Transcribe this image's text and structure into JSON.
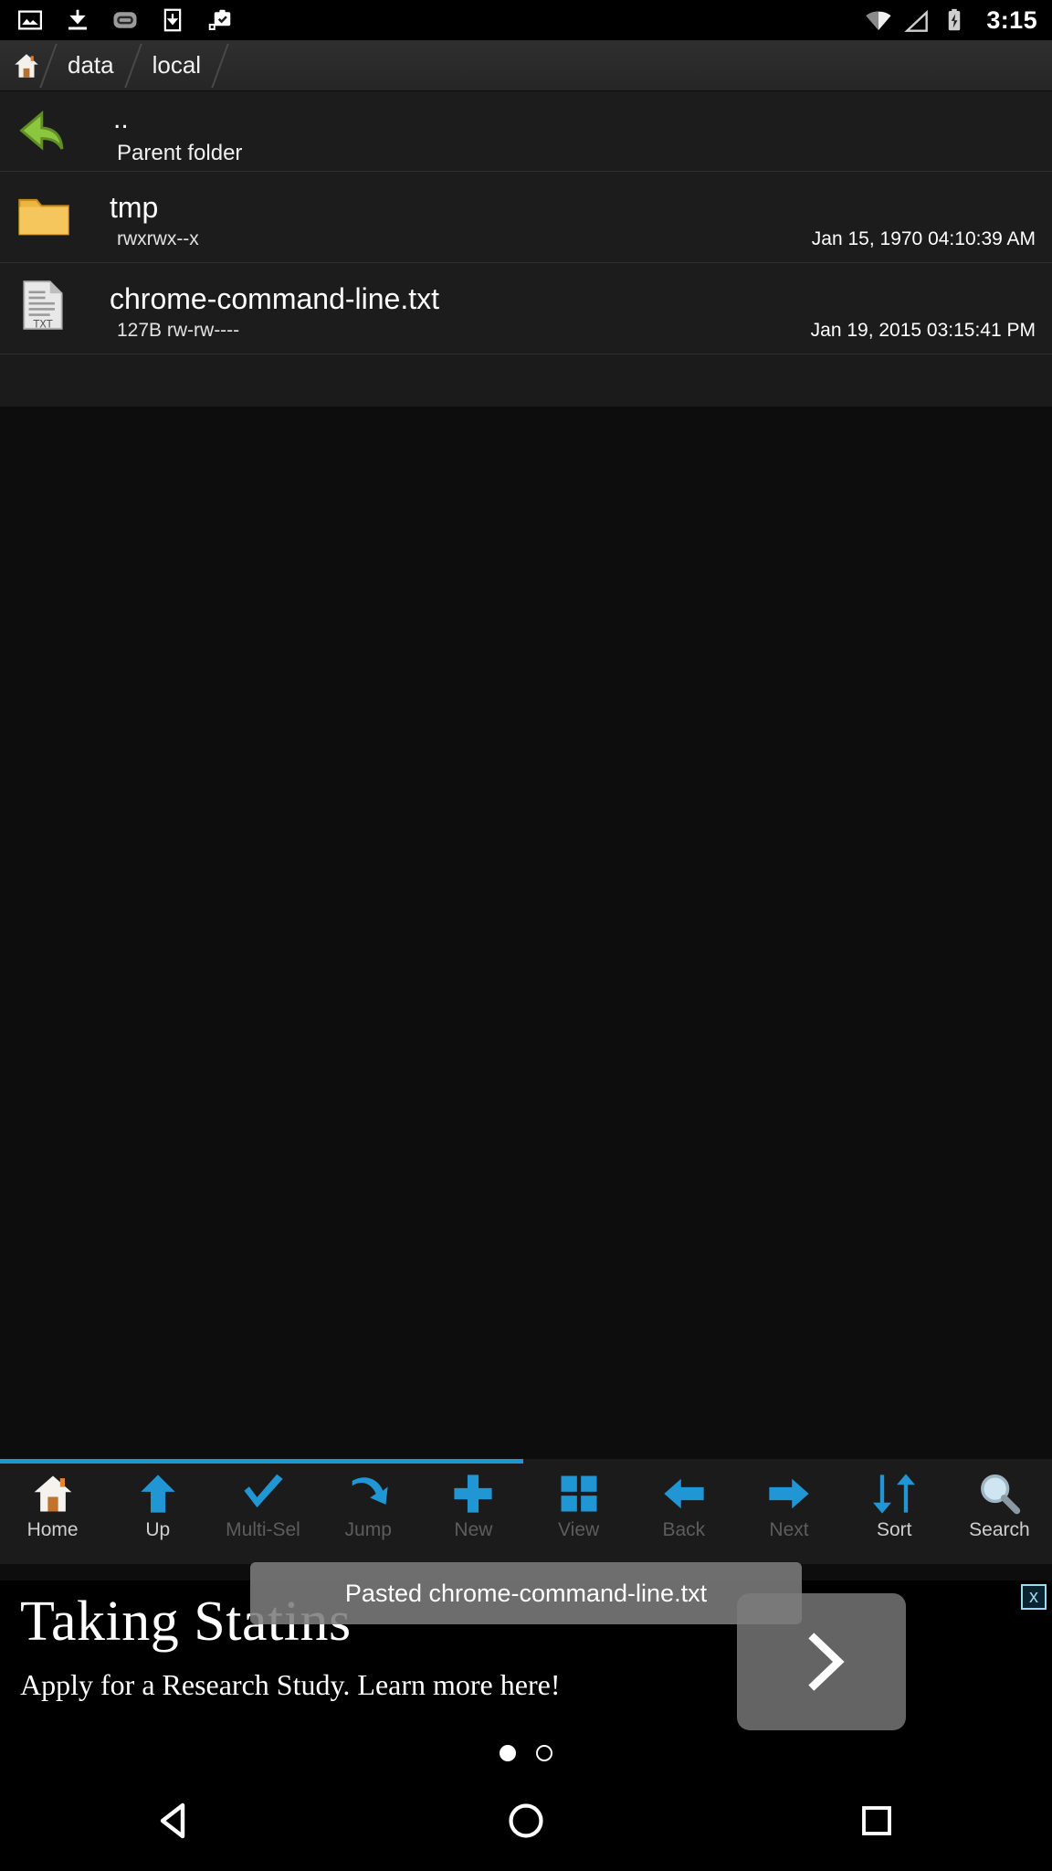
{
  "status_bar": {
    "icons": [
      "image-icon",
      "download-icon",
      "app-icon",
      "save-to-device-icon",
      "clipboard-check-icon"
    ],
    "right_icons": [
      "wifi-icon",
      "cell-signal-icon",
      "battery-charging-icon"
    ],
    "time": "3:15"
  },
  "breadcrumb": {
    "home_icon": "home-icon",
    "segments": [
      {
        "label": "data"
      },
      {
        "label": "local"
      }
    ]
  },
  "file_list": {
    "parent": {
      "icon": "back-arrow-icon",
      "name": "..",
      "label": "Parent folder"
    },
    "columns": [
      "name",
      "details",
      "date"
    ],
    "items": [
      {
        "icon": "folder-icon",
        "name": "tmp",
        "details": "rwxrwx--x",
        "date": "Jan 15, 1970 04:10:39 AM"
      },
      {
        "icon": "text-file-icon",
        "icon_label": "TXT",
        "name": "chrome-command-line.txt",
        "details": "127B rw-rw----",
        "date": "Jan 19, 2015 03:15:41 PM"
      }
    ]
  },
  "toolbar": {
    "accent_color": "#2196d4",
    "items": [
      {
        "label": "Home",
        "icon": "home-icon",
        "enabled": true
      },
      {
        "label": "Up",
        "icon": "arrow-up-icon",
        "enabled": true
      },
      {
        "label": "Multi-Sel",
        "icon": "check-icon",
        "enabled": false
      },
      {
        "label": "Jump",
        "icon": "jump-arrow-icon",
        "enabled": false
      },
      {
        "label": "New",
        "icon": "plus-icon",
        "enabled": false
      },
      {
        "label": "View",
        "icon": "grid-icon",
        "enabled": false
      },
      {
        "label": "Back",
        "icon": "arrow-left-icon",
        "enabled": false
      },
      {
        "label": "Next",
        "icon": "arrow-right-icon",
        "enabled": false
      },
      {
        "label": "Sort",
        "icon": "sort-icon",
        "enabled": true
      },
      {
        "label": "Search",
        "icon": "search-icon",
        "enabled": true
      }
    ]
  },
  "toast": {
    "message": "Pasted chrome-command-line.txt"
  },
  "advertisement": {
    "headline": "Taking Statins",
    "subtext": "Apply for a Research Study. Learn more here!",
    "next_icon": "chevron-right-icon",
    "close_label": "x",
    "pager": {
      "count": 2,
      "active": 0
    }
  },
  "navigation_bar": {
    "buttons": [
      {
        "name": "back",
        "icon": "triangle-back-icon"
      },
      {
        "name": "home",
        "icon": "circle-home-icon"
      },
      {
        "name": "recent",
        "icon": "square-recents-icon"
      }
    ]
  }
}
